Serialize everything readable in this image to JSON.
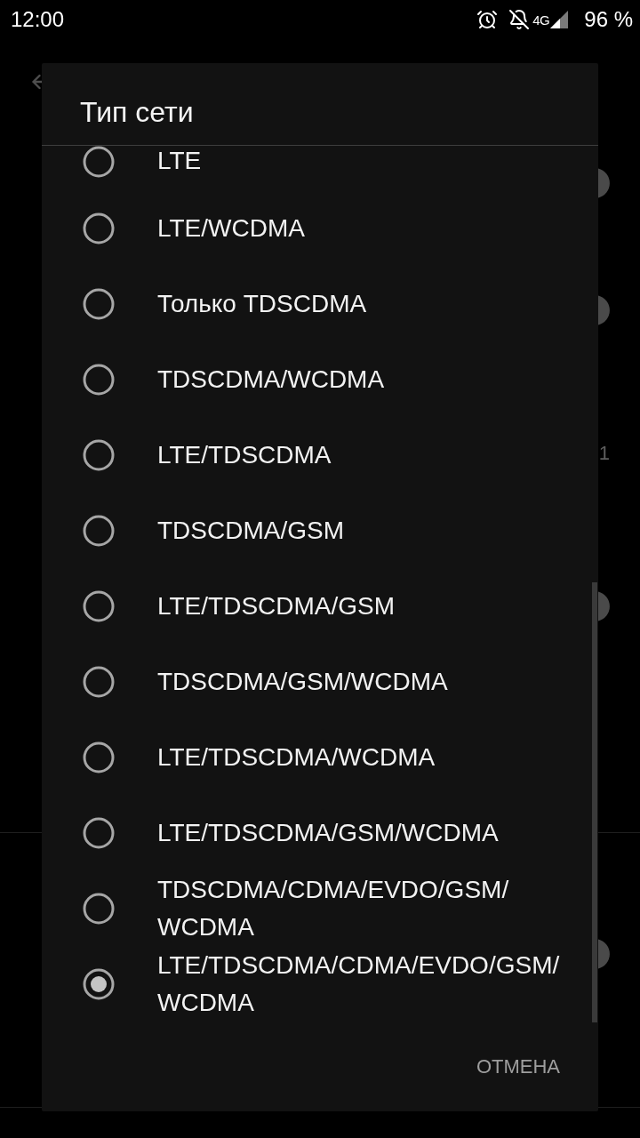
{
  "status_bar": {
    "time": "12:00",
    "network": "4G",
    "battery": "96 %"
  },
  "background": {
    "sections": [
      {
        "rows": [
          {
            "kind": "toggle"
          },
          {
            "kind": "toggle"
          },
          {
            "kind": "value",
            "text": "1"
          },
          {
            "kind": "toggle"
          }
        ]
      },
      {
        "rows": [
          {
            "kind": "toggle"
          }
        ]
      }
    ]
  },
  "dialog": {
    "title": "Тип сети",
    "options": [
      {
        "label": "LTE",
        "selected": false
      },
      {
        "label": "LTE/WCDMA",
        "selected": false
      },
      {
        "label": "Только TDSCDMA",
        "selected": false
      },
      {
        "label": "TDSCDMA/WCDMA",
        "selected": false
      },
      {
        "label": "LTE/TDSCDMA",
        "selected": false
      },
      {
        "label": "TDSCDMA/GSM",
        "selected": false
      },
      {
        "label": "LTE/TDSCDMA/GSM",
        "selected": false
      },
      {
        "label": "TDSCDMA/GSM/WCDMA",
        "selected": false
      },
      {
        "label": "LTE/TDSCDMA/WCDMA",
        "selected": false
      },
      {
        "label": "LTE/TDSCDMA/GSM/WCDMA",
        "selected": false
      },
      {
        "label": "TDSCDMA/CDMA/EVDO/GSM/WCDMA",
        "selected": false
      },
      {
        "label": "LTE/TDSCDMA/CDMA/EVDO/GSM/WCDMA",
        "selected": true
      }
    ],
    "buttons": [
      {
        "label": "ОТМЕНА"
      }
    ]
  }
}
